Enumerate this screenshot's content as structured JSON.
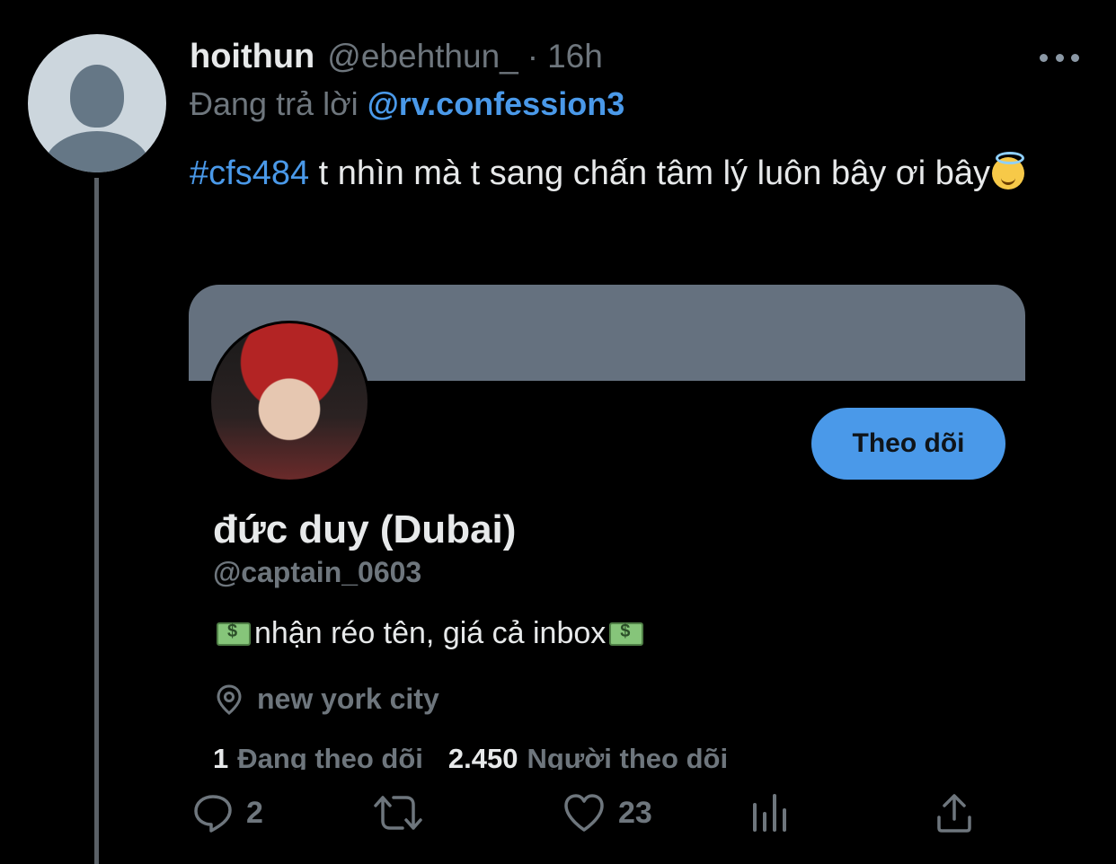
{
  "tweet": {
    "author_name": "hoithun",
    "author_handle": "@ebehthun_",
    "separator": "·",
    "time": "16h",
    "reply_prefix": "Đang trả lời",
    "reply_to": "@rv.confession3",
    "hashtag": "#cfs484",
    "text": " t nhìn mà t sang chấn tâm lý luôn bây ơi bây",
    "emoji": "smiling-face-with-halo-icon"
  },
  "profile_card": {
    "display_name": "đức duy (Dubai)",
    "handle": "@captain_0603",
    "bio": " nhận réo tên, giá cả inbox",
    "bio_emoji": "money-bill-icon",
    "location": "new york city",
    "follow_label": "Theo dõi",
    "following_count": "1",
    "following_label": "Đang theo dõi",
    "followers_count": "2.450",
    "followers_label": "Người theo dõi"
  },
  "actions": {
    "reply_count": "2",
    "retweet_count": "",
    "like_count": "23"
  },
  "colors": {
    "background": "#000000",
    "link": "#4a99e9",
    "muted": "#6e767d",
    "banner": "#65717f"
  }
}
